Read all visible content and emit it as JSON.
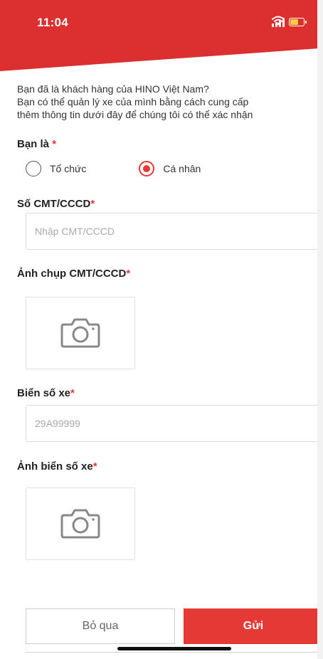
{
  "status_bar": {
    "time": "11:04"
  },
  "colors": {
    "brand_red": "#e53935",
    "header_red": "#dc2f2f"
  },
  "intro": {
    "line1": "Bạn đã là khách hàng của HINO Việt Nam?",
    "line2": "Bạn có thể quản lý xe của mình bằng cách cung cấp",
    "line3": "thêm thông tin dưới đây để chúng tôi có thể xác nhận"
  },
  "customer_type": {
    "label": "Bạn là",
    "required_mark": "*",
    "options": [
      "Tổ chức",
      "Cá nhân"
    ],
    "selected": "Cá nhân"
  },
  "id_number": {
    "label": "Số CMT/CCCD",
    "required_mark": "*",
    "placeholder": "Nhập CMT/CCCD",
    "value": ""
  },
  "id_photo": {
    "label": "Ảnh chụp CMT/CCCD",
    "required_mark": "*",
    "icon": "camera-icon"
  },
  "plate_number": {
    "label": "Biển số xe",
    "required_mark": "*",
    "placeholder": "29A99999",
    "value": ""
  },
  "plate_photo": {
    "label": "Ảnh biển số xe",
    "required_mark": "*",
    "icon": "camera-icon"
  },
  "actions": {
    "skip_label": "Bỏ qua",
    "send_label": "Gửi"
  }
}
